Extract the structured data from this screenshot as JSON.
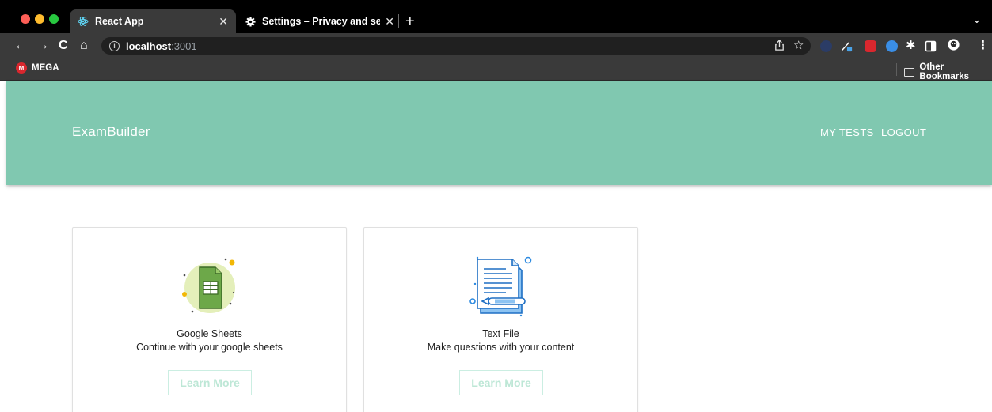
{
  "browser": {
    "tabs": [
      {
        "title": "React App",
        "active": true,
        "icon": "react-logo-icon"
      },
      {
        "title": "Settings – Privacy and security",
        "active": false,
        "icon": "gear-icon"
      }
    ],
    "address": {
      "host": "localhost",
      "port": ":3001"
    },
    "bookmarks": {
      "left": "MEGA",
      "right": "Other Bookmarks"
    }
  },
  "colors": {
    "header": "#80c8b0",
    "button_text": "#bde7d6",
    "button_border": "#cbeee2"
  },
  "header": {
    "brand": "ExamBuilder",
    "nav": [
      "MY TESTS",
      "LOGOUT"
    ]
  },
  "cards": [
    {
      "title": "Google Sheets",
      "description": "Continue with your google sheets",
      "button": "Learn More",
      "icon": "google-sheets-icon"
    },
    {
      "title": "Text File",
      "description": "Make questions with your content",
      "button": "Learn More",
      "icon": "text-file-icon"
    }
  ]
}
